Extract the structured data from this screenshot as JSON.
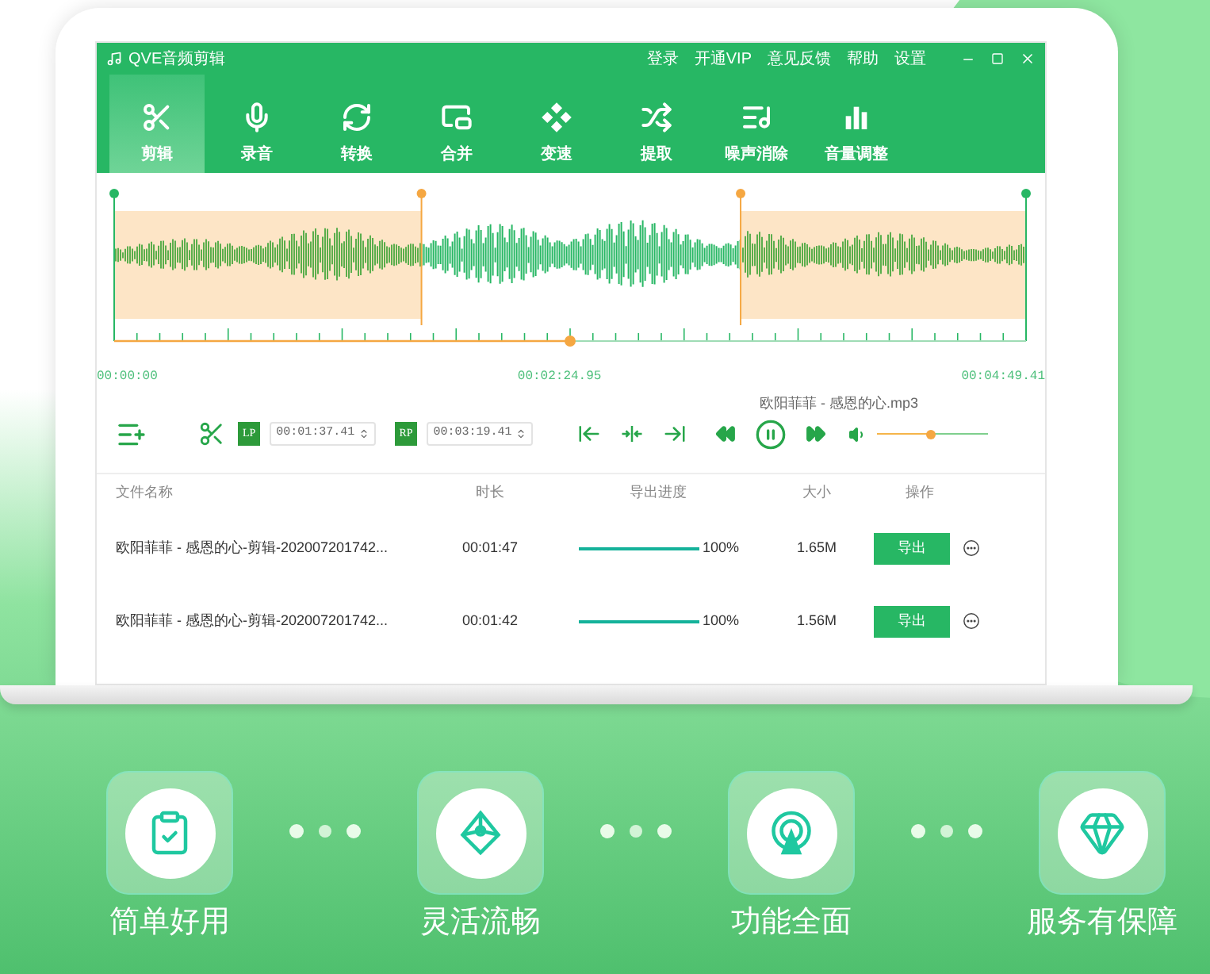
{
  "app": {
    "title": "QVE音频剪辑",
    "menu": [
      "登录",
      "开通VIP",
      "意见反馈",
      "帮助",
      "设置"
    ]
  },
  "tabs": [
    {
      "label": "剪辑",
      "selected": true
    },
    {
      "label": "录音",
      "selected": false
    },
    {
      "label": "转换",
      "selected": false
    },
    {
      "label": "合并",
      "selected": false
    },
    {
      "label": "变速",
      "selected": false
    },
    {
      "label": "提取",
      "selected": false
    },
    {
      "label": "噪声消除",
      "selected": false
    },
    {
      "label": "音量调整",
      "selected": false
    }
  ],
  "timeline": {
    "markers": [
      {
        "level": 0.337
      },
      {
        "level": 0.687
      }
    ],
    "playhead": {
      "level": 0.5
    },
    "start": "00:00:00",
    "current": "00:02:24.95",
    "end": "00:04:49.41"
  },
  "player": {
    "now_playing": "欧阳菲菲 - 感恩的心.mp3",
    "lp_label": "LP",
    "lp_time": "00:01:37.41",
    "rp_label": "RP",
    "rp_time": "00:03:19.41",
    "volume": {
      "level": 0.49
    }
  },
  "table": {
    "columns": [
      "文件名称",
      "时长",
      "导出进度",
      "大小",
      "操作"
    ],
    "rows": [
      {
        "name": "欧阳菲菲 - 感恩的心-剪辑-202007201742...",
        "duration": "00:01:47",
        "level": 1,
        "progress": "100%",
        "size": "1.65M",
        "action": "导出"
      },
      {
        "name": "欧阳菲菲 - 感恩的心-剪辑-202007201742...",
        "duration": "00:01:42",
        "level": 1,
        "progress": "100%",
        "size": "1.56M",
        "action": "导出"
      }
    ]
  },
  "features": [
    {
      "label": "简单好用"
    },
    {
      "label": "灵活流畅"
    },
    {
      "label": "功能全面"
    },
    {
      "label": "服务有保障"
    }
  ]
}
